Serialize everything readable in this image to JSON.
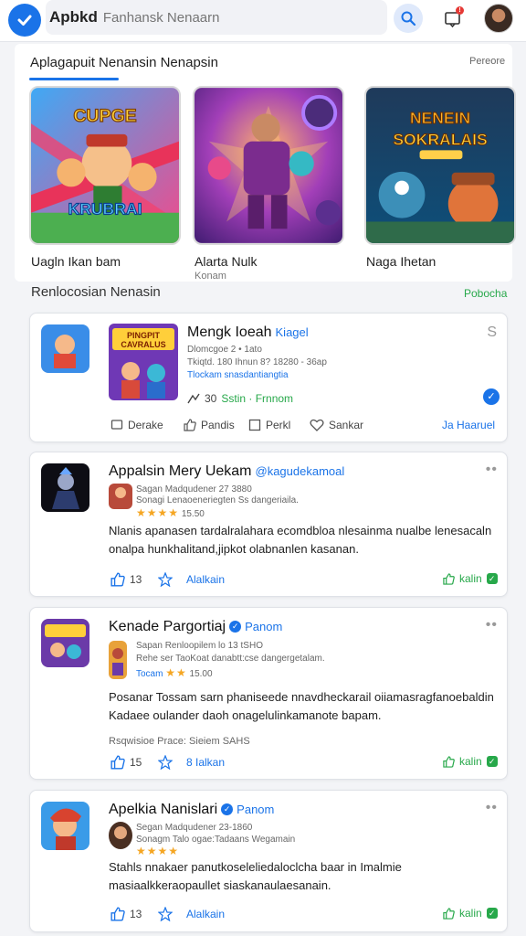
{
  "header": {
    "app_name": "Apbkd",
    "search_placeholder": "Fanhansk Nenaarn"
  },
  "featured": {
    "title": "Aplagapuit Nenansin Nenapsin",
    "link": "Pereore",
    "tiles": [
      {
        "name": "Uagln Ikan bam",
        "sub": "",
        "banner_top": "CUPGE",
        "banner_bottom": "KRUBRAI"
      },
      {
        "name": "Alarta Nulk",
        "sub": "Konam",
        "banner_top": "",
        "banner_bottom": ""
      },
      {
        "name": "Naga Ihetan",
        "sub": "",
        "banner_top": "NENEIN",
        "banner_bottom": "SOKRALAIS"
      }
    ]
  },
  "recommend": {
    "title": "Renlocosian Nenasin",
    "link": "Pobocha"
  },
  "cards": [
    {
      "title": "Mengk Ioeah",
      "tag": "Kiagel",
      "corner": "S",
      "meta1": "Dlomcgoe 2 • 1ato",
      "meta2": "Tkiqtd. 180 Ihnun 8? 18280 - 36ap",
      "meta3": "Tlockam snasdantiangtia",
      "rating": "30",
      "rating_label": "Sstin · Frnnom",
      "thumb_text_top": "PINGPIT",
      "thumb_text_bottom": "CAVRALUS",
      "actions": [
        "Derake",
        "Pandis",
        "Perkl",
        "Sankar"
      ],
      "action_right": "Ja Haaruel"
    },
    {
      "title": "Appalsin Mery Uekam",
      "tag": "@kagudekamoal",
      "sub1": "Sagan Madqudener 27 3880",
      "sub2": "Sonagi Lenaoeneriegten Ss dangeriaila.",
      "rating_num": "15.50",
      "body": "Nlanis apanasen tardalralahara ecomdbloa nlesainma nualbe lenesacaln onalpa hunkhalitand,jipkot olabnanlen kasanan.",
      "like_count": "13",
      "mid_action": "Alalkain",
      "right_action": "kalin"
    },
    {
      "title": "Kenade Pargortiaj",
      "tag": "Panom",
      "sub1": "Sapan Renloopilem lo 13 tSHO",
      "sub2": "Rehe ser TaoKoat danabtt:cse dangergetalam.",
      "sub3": "Tocam",
      "rating_num": "15.00",
      "body": "Posanar Tossam sarn phaniseede nnavdheckarail oiiamasragfanoebaldin Kadaee oulander daoh onagelulinkamanote bapam.",
      "footer_line": "Rsqwisioe Prace: Sieiem SAHS",
      "like_count": "15",
      "mid_action": "8 Ialkan",
      "right_action": "kalin"
    },
    {
      "title": "Apelkia Nanislari",
      "tag": "Panom",
      "sub1": "Segan Madqudener 23-1860",
      "sub2": "Sonagm Talo ogae:Tadaans Wegamain",
      "body": "Stahls nnakaer panutkoseleliedaloclcha baar in Imalmie masiaalkkeraopaullet siaskanaulaesanain.",
      "like_count": "13",
      "mid_action": "Alalkain",
      "right_action": "kalin"
    }
  ],
  "colors": {
    "accent": "#1a73e8",
    "green": "#27a84a",
    "star": "#f5a623"
  },
  "icons": [
    "check-icon",
    "search-icon",
    "notification-icon",
    "thumbs-up-icon",
    "star-outline-icon",
    "heart-icon",
    "share-icon",
    "bookmark-icon",
    "more-icon"
  ]
}
